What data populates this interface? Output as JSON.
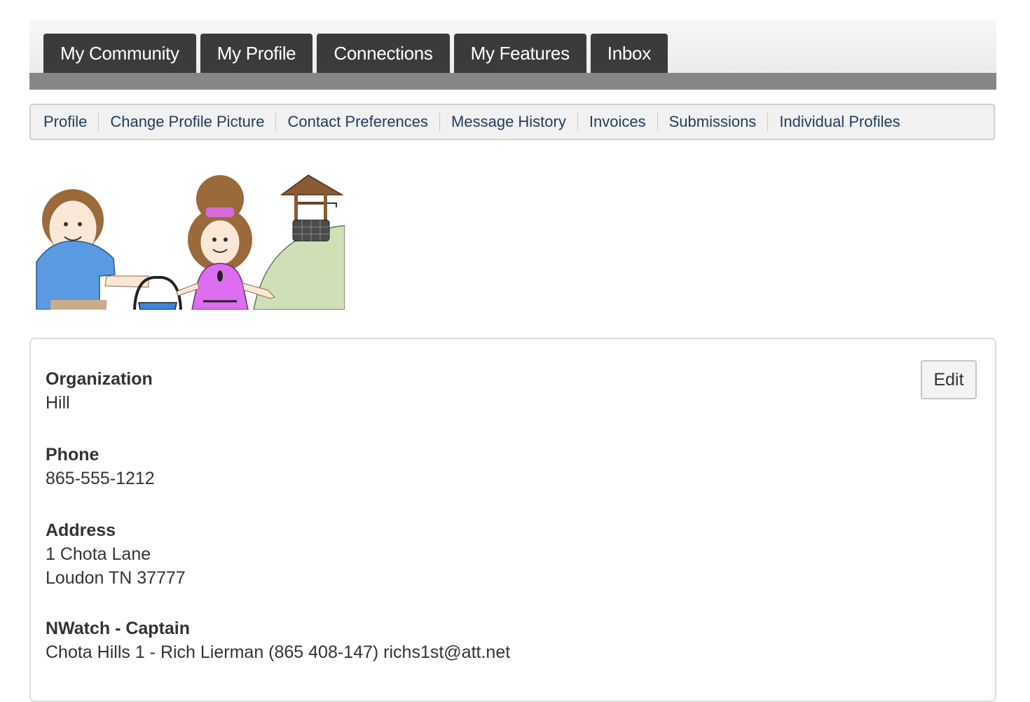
{
  "main_nav": {
    "tabs": [
      {
        "label": "My Community"
      },
      {
        "label": "My Profile"
      },
      {
        "label": "Connections"
      },
      {
        "label": "My Features"
      },
      {
        "label": "Inbox"
      }
    ]
  },
  "sub_nav": {
    "items": [
      {
        "label": "Profile"
      },
      {
        "label": "Change Profile Picture"
      },
      {
        "label": "Contact Preferences"
      },
      {
        "label": "Message History"
      },
      {
        "label": "Invoices"
      },
      {
        "label": "Submissions"
      },
      {
        "label": "Individual Profiles"
      }
    ]
  },
  "profile": {
    "edit_label": "Edit",
    "organization": {
      "label": "Organization",
      "value": "Hill"
    },
    "phone": {
      "label": "Phone",
      "value": "865-555-1212"
    },
    "address": {
      "label": "Address",
      "line1": "1 Chota Lane",
      "line2": "Loudon TN 37777"
    },
    "nwatch": {
      "label": "NWatch - Captain",
      "value": "Chota Hills 1 - Rich Lierman (865 408-147) richs1st@att.net"
    }
  },
  "colors": {
    "tab_bg": "#3b3b3b",
    "strip": "#868686",
    "link": "#223d5e"
  }
}
